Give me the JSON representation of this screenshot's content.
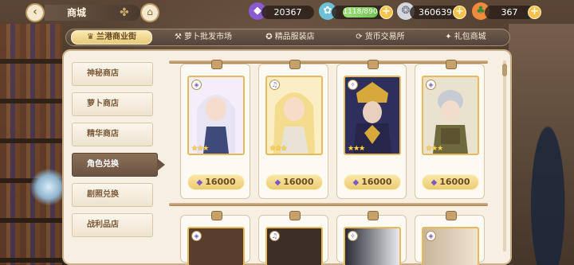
{
  "header": {
    "title": "商城",
    "resources": [
      {
        "name": "gem",
        "icon": "purple-gem-icon",
        "value": "20367"
      },
      {
        "name": "stamina",
        "icon": "stamina-icon",
        "value": "1118/890"
      },
      {
        "name": "coin",
        "icon": "silver-coin-icon",
        "value": "360639"
      },
      {
        "name": "carrot",
        "icon": "carrot-icon",
        "value": "367"
      }
    ]
  },
  "tabs": [
    {
      "label": "兰港商业街",
      "icon": "crown-icon",
      "active": true
    },
    {
      "label": "萝卜批发市场",
      "icon": "hammer-icon",
      "active": false
    },
    {
      "label": "精品服装店",
      "icon": "clothes-icon",
      "active": false
    },
    {
      "label": "货币交易所",
      "icon": "exchange-icon",
      "active": false
    },
    {
      "label": "礼包商城",
      "icon": "gift-icon",
      "active": false
    }
  ],
  "sidebar": {
    "items": [
      {
        "label": "神秘商店",
        "active": false
      },
      {
        "label": "萝卜商店",
        "active": false
      },
      {
        "label": "精华商店",
        "active": false
      },
      {
        "label": "角色兑换",
        "active": true
      },
      {
        "label": "剧照兑换",
        "active": false
      },
      {
        "label": "战利品店",
        "active": false
      }
    ]
  },
  "cards": [
    {
      "price": "16000",
      "stars": "★★★",
      "attr_icon": "attribute-icon",
      "palette": [
        "#e9e4f4",
        "#f4f1fa",
        "#3e4a7a",
        "#f6dccd"
      ]
    },
    {
      "price": "16000",
      "stars": "★★★",
      "attr_icon": "attribute-icon",
      "palette": [
        "#f4dc8e",
        "#fbeec4",
        "#e8e3d4",
        "#f7ddc8"
      ]
    },
    {
      "price": "16000",
      "stars": "★★★",
      "attr_icon": "attribute-icon",
      "palette": [
        "#2e2f5c",
        "#d6a93a",
        "#27254a",
        "#e9d0bd"
      ]
    },
    {
      "price": "16000",
      "stars": "★★★",
      "attr_icon": "attribute-icon",
      "palette": [
        "#c7cbd4",
        "#6f6a3e",
        "#5c5330",
        "#f2dccb"
      ]
    }
  ],
  "cards_row2": [
    {
      "attr_icon": "attribute-icon",
      "palette": [
        "#5a3e2c",
        "#8a6a4c"
      ]
    },
    {
      "attr_icon": "attribute-icon",
      "palette": [
        "#3d2e28",
        "#7a5a44"
      ]
    },
    {
      "attr_icon": "attribute-icon",
      "palette": [
        "#2a2a34",
        "#e8e8ee"
      ]
    },
    {
      "attr_icon": "attribute-icon",
      "palette": [
        "#c8b49a",
        "#efe3d2"
      ]
    }
  ]
}
